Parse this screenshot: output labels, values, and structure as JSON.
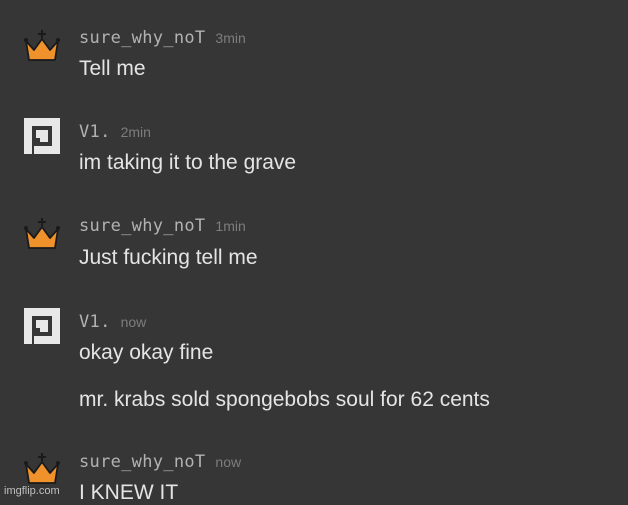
{
  "colors": {
    "background": "#363636",
    "username": "#b2b2b2",
    "timestamp": "#7d7d7d",
    "message_text": "#e4e4e4",
    "crown_orange": "#f0922c",
    "v1_logo": "#e8e8e8"
  },
  "messages": [
    {
      "avatar_icon": "crown-icon",
      "username": "sure_why_noT",
      "time": "3min",
      "lines": [
        "Tell me"
      ]
    },
    {
      "avatar_icon": "v1-logo-icon",
      "username": "V1.",
      "time": "2min",
      "lines": [
        "im taking it to the grave"
      ]
    },
    {
      "avatar_icon": "crown-icon",
      "username": "sure_why_noT",
      "time": "1min",
      "lines": [
        "Just fucking tell me"
      ]
    },
    {
      "avatar_icon": "v1-logo-icon",
      "username": "V1.",
      "time": "now",
      "lines": [
        "okay okay fine",
        "mr. krabs sold spongebobs soul for 62 cents"
      ]
    },
    {
      "avatar_icon": "crown-icon",
      "username": "sure_why_noT",
      "time": "now",
      "lines": [
        "I KNEW IT"
      ]
    }
  ],
  "watermark": "imgflip.com"
}
